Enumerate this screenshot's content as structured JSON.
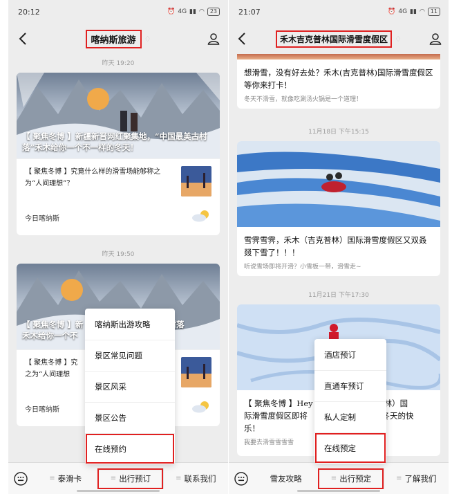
{
  "left": {
    "status": {
      "time": "20:12",
      "signal": "4G",
      "battery": "23"
    },
    "nav": {
      "title": "喀纳斯旅游"
    },
    "messages": [
      {
        "time": "昨天 19:20",
        "hero_title": "【 聚焦冬博 】新疆新晋网红聚集地，“中国最美古村落”禾木给你一个不一样的冬天！",
        "sub_title": "【 聚焦冬博 】究竟什么样的滑雪场能够称之为“人间理想”？",
        "footer": "今日喀纳斯"
      },
      {
        "time": "昨天 19:50",
        "hero_title_a": "【 聚焦冬博 】新",
        "hero_title_b": "童话村落",
        "hero_title_c": "禾木给你一个不",
        "sub_title_a": "【 聚焦冬博 】究",
        "sub_title_b": "之为“人间理想",
        "footer": "今日喀纳斯"
      }
    ],
    "popup": [
      "喀纳斯出游攻略",
      "景区常见问题",
      "景区风采",
      "景区公告",
      "在线预约"
    ],
    "menu": [
      "泰滑卡",
      "出行预订",
      "联系我们"
    ]
  },
  "right": {
    "status": {
      "time": "21:07",
      "signal": "4G",
      "battery": "11"
    },
    "nav": {
      "title": "禾木吉克普林国际滑雪度假区"
    },
    "top_article": {
      "title": "想滑雪，没有好去处？禾木(吉克普林)国际滑雪度假区等你来打卡！",
      "desc": "冬天不滑雪，就像吃涮汤火锅是一个道理！"
    },
    "article2": {
      "time": "11月18日 下午15:15",
      "title": "雪霁雪霁，禾木（吉克普林）国际滑雪度假区又双叒叕下雪了！！！",
      "desc": "听说雪场即将开滑？小雪板一带，滑雪走~"
    },
    "article3": {
      "time": "11月21日 下午17:30",
      "title_a": "【 聚焦冬博 】Hey",
      "title_b": "克普林）国",
      "title_c": "际滑雪度假区即将",
      "title_d": "个冬天的快",
      "title_e": "乐！",
      "desc": "我要去滑雪雪雪雪"
    },
    "popup": [
      "酒店预订",
      "直通车预订",
      "私人定制",
      "在线预定"
    ],
    "menu": [
      "雪友攻略",
      "出行预定",
      "了解我们"
    ]
  },
  "colors": {
    "highlight": "#e02020",
    "background": "#ededed",
    "card": "#ffffff"
  }
}
